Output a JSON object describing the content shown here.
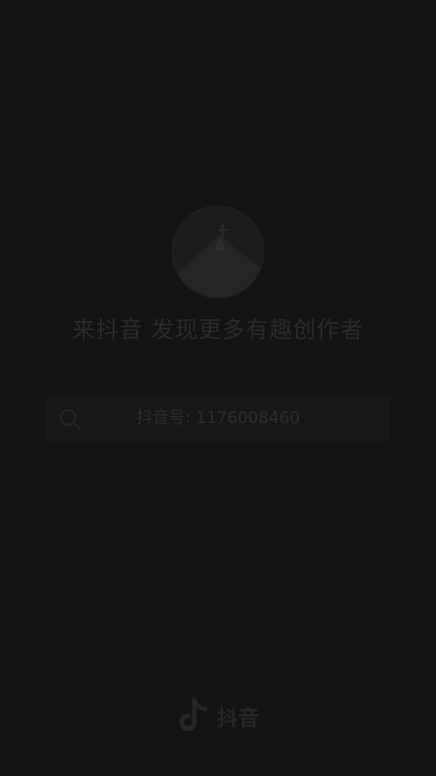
{
  "promo": {
    "headline": "来抖音 发现更多有趣创作者"
  },
  "search": {
    "text": "抖音号: 1176008460"
  },
  "brand": {
    "name": "抖音",
    "logo_icon": "tiktok-note-icon"
  },
  "colors": {
    "background": "#131313",
    "search_background": "#171717",
    "text": "#2b2b2b"
  }
}
